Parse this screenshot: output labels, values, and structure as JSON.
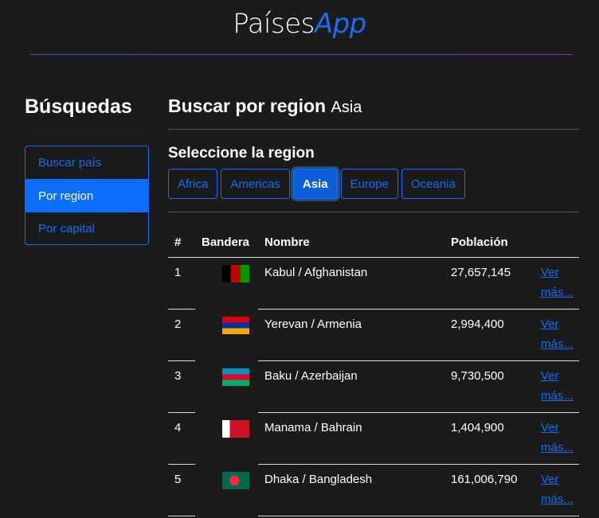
{
  "brand": {
    "name": "Países",
    "suffix": "App"
  },
  "sidebar": {
    "title": "Búsquedas",
    "items": [
      {
        "label": "Buscar país"
      },
      {
        "label": "Por region",
        "active": true
      },
      {
        "label": "Por capital"
      }
    ]
  },
  "main": {
    "title": "Buscar por region",
    "region": "Asia",
    "select_title": "Seleccione la region",
    "regions": [
      "Africa",
      "Americas",
      "Asia",
      "Europe",
      "Oceania"
    ],
    "active_region": "Asia"
  },
  "table": {
    "headers": [
      "#",
      "Bandera",
      "Nombre",
      "Población",
      ""
    ],
    "rows": [
      {
        "n": "1",
        "flag": "afghanistan-flag",
        "name": "Kabul / Afghanistan",
        "pop": "27,657,145",
        "link": "Ver más..."
      },
      {
        "n": "2",
        "flag": "armenia-flag",
        "name": "Yerevan / Armenia",
        "pop": "2,994,400",
        "link": "Ver más..."
      },
      {
        "n": "3",
        "flag": "azerbaijan-flag",
        "name": "Baku / Azerbaijan",
        "pop": "9,730,500",
        "link": "Ver más..."
      },
      {
        "n": "4",
        "flag": "bahrain-flag",
        "name": "Manama / Bahrain",
        "pop": "1,404,900",
        "link": "Ver más..."
      },
      {
        "n": "5",
        "flag": "bangladesh-flag",
        "name": "Dhaka / Bangladesh",
        "pop": "161,006,790",
        "link": "Ver más..."
      }
    ]
  },
  "colors": {
    "accent": "#0d6efd",
    "background": "#1b1b1b"
  }
}
